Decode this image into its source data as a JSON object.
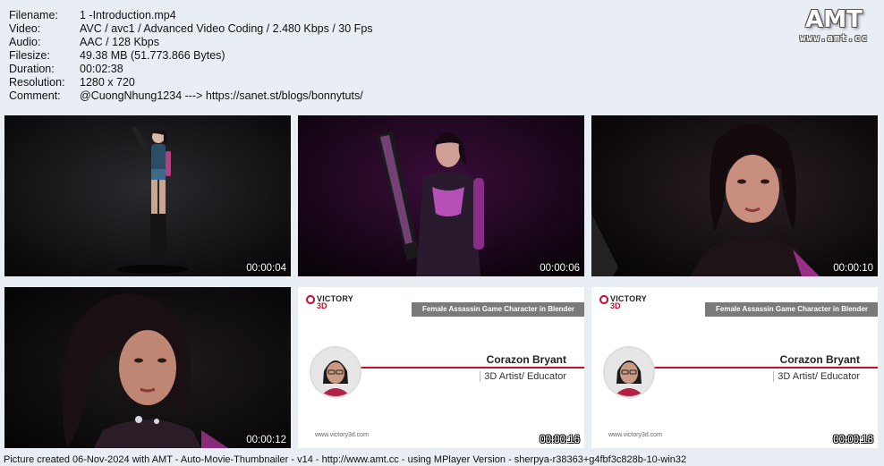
{
  "info": {
    "rows": [
      {
        "key": "Filename:",
        "value": "1 -Introduction.mp4"
      },
      {
        "key": "Video:",
        "value": "AVC / avc1 / Advanced Video Coding / 2.480 Kbps / 30 Fps"
      },
      {
        "key": "Audio:",
        "value": "AAC / 128 Kbps"
      },
      {
        "key": "Filesize:",
        "value": "49.38 MB (51.773.866 Bytes)"
      },
      {
        "key": "Duration:",
        "value": "00:02:38"
      },
      {
        "key": "Resolution:",
        "value": "1280 x 720"
      },
      {
        "key": "Comment:",
        "value": "@CuongNhung1234 ---> https://sanet.st/blogs/bonnytuts/"
      }
    ]
  },
  "logo": {
    "mark": "AMT",
    "url": "www.amt.cc"
  },
  "thumbnails": [
    {
      "timestamp": "00:00:04"
    },
    {
      "timestamp": "00:00:06"
    },
    {
      "timestamp": "00:00:10"
    },
    {
      "timestamp": "00:00:12"
    },
    {
      "timestamp": "00:00:16"
    },
    {
      "timestamp": "00:00:18"
    }
  ],
  "slide": {
    "logo_top": "VICTORY",
    "logo_bottom": "3D",
    "banner": "Female Assassin Game Character in Blender",
    "name": "Corazon Bryant",
    "role": "3D Artist/ Educator",
    "url": "www.victory3d.com"
  },
  "footer": "Picture created 06-Nov-2024 with AMT - Auto-Movie-Thumbnailer - v14 - http://www.amt.cc - using MPlayer Version - sherpya-r38363+g4fbf3c828b-10-win32",
  "colors": {
    "background": "#e9edf4",
    "accent_red": "#c8102e",
    "banner_gray": "#7a7a7a"
  }
}
